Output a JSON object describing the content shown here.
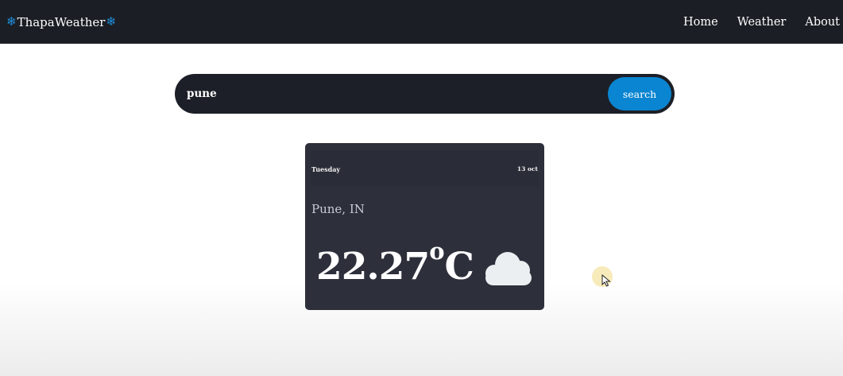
{
  "navbar": {
    "brand_left_icon": "snowflake-icon",
    "brand": "ThapaWeather",
    "brand_right_icon": "snowflake-icon",
    "links": [
      {
        "label": "Home"
      },
      {
        "label": "Weather"
      },
      {
        "label": "About"
      }
    ]
  },
  "search": {
    "value": "pune",
    "button_label": "search"
  },
  "weather": {
    "day": "Tuesday",
    "date": "13 oct",
    "location": "Pune, IN",
    "temperature": "22.27",
    "degree_symbol": "o",
    "unit": "C",
    "condition_icon": "cloud-icon"
  },
  "colors": {
    "navbar_bg": "#1b1f25",
    "accent": "#0a85d1",
    "card_bg": "#2d2f3b",
    "search_bg": "#1c1f27"
  }
}
